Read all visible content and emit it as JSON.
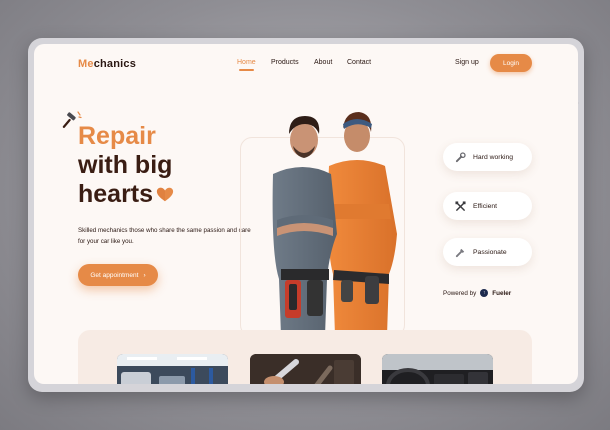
{
  "brand": {
    "prefix": "Me",
    "rest": "chanics"
  },
  "nav": {
    "items": [
      {
        "label": "Home",
        "active": true
      },
      {
        "label": "Products",
        "active": false
      },
      {
        "label": "About",
        "active": false
      },
      {
        "label": "Contact",
        "active": false
      }
    ],
    "signup_label": "Sign up",
    "login_label": "Login"
  },
  "hero": {
    "title_accent": "Repair",
    "title_line2": "with big",
    "title_line3": "hearts",
    "subtitle": "Skilled mechanics those who share the same passion and care for your car like you.",
    "cta_label": "Get appointment",
    "cta_arrow": "›"
  },
  "features": [
    {
      "label": "Hard working",
      "icon": "wrench-icon"
    },
    {
      "label": "Efficient",
      "icon": "tools-icon"
    },
    {
      "label": "Passionate",
      "icon": "spanner-icon"
    }
  ],
  "powered": {
    "prefix": "Powered by",
    "brand": "Fueler"
  },
  "colors": {
    "accent": "#e68a47",
    "dark": "#3a1d13",
    "background": "#fdf8f5"
  }
}
